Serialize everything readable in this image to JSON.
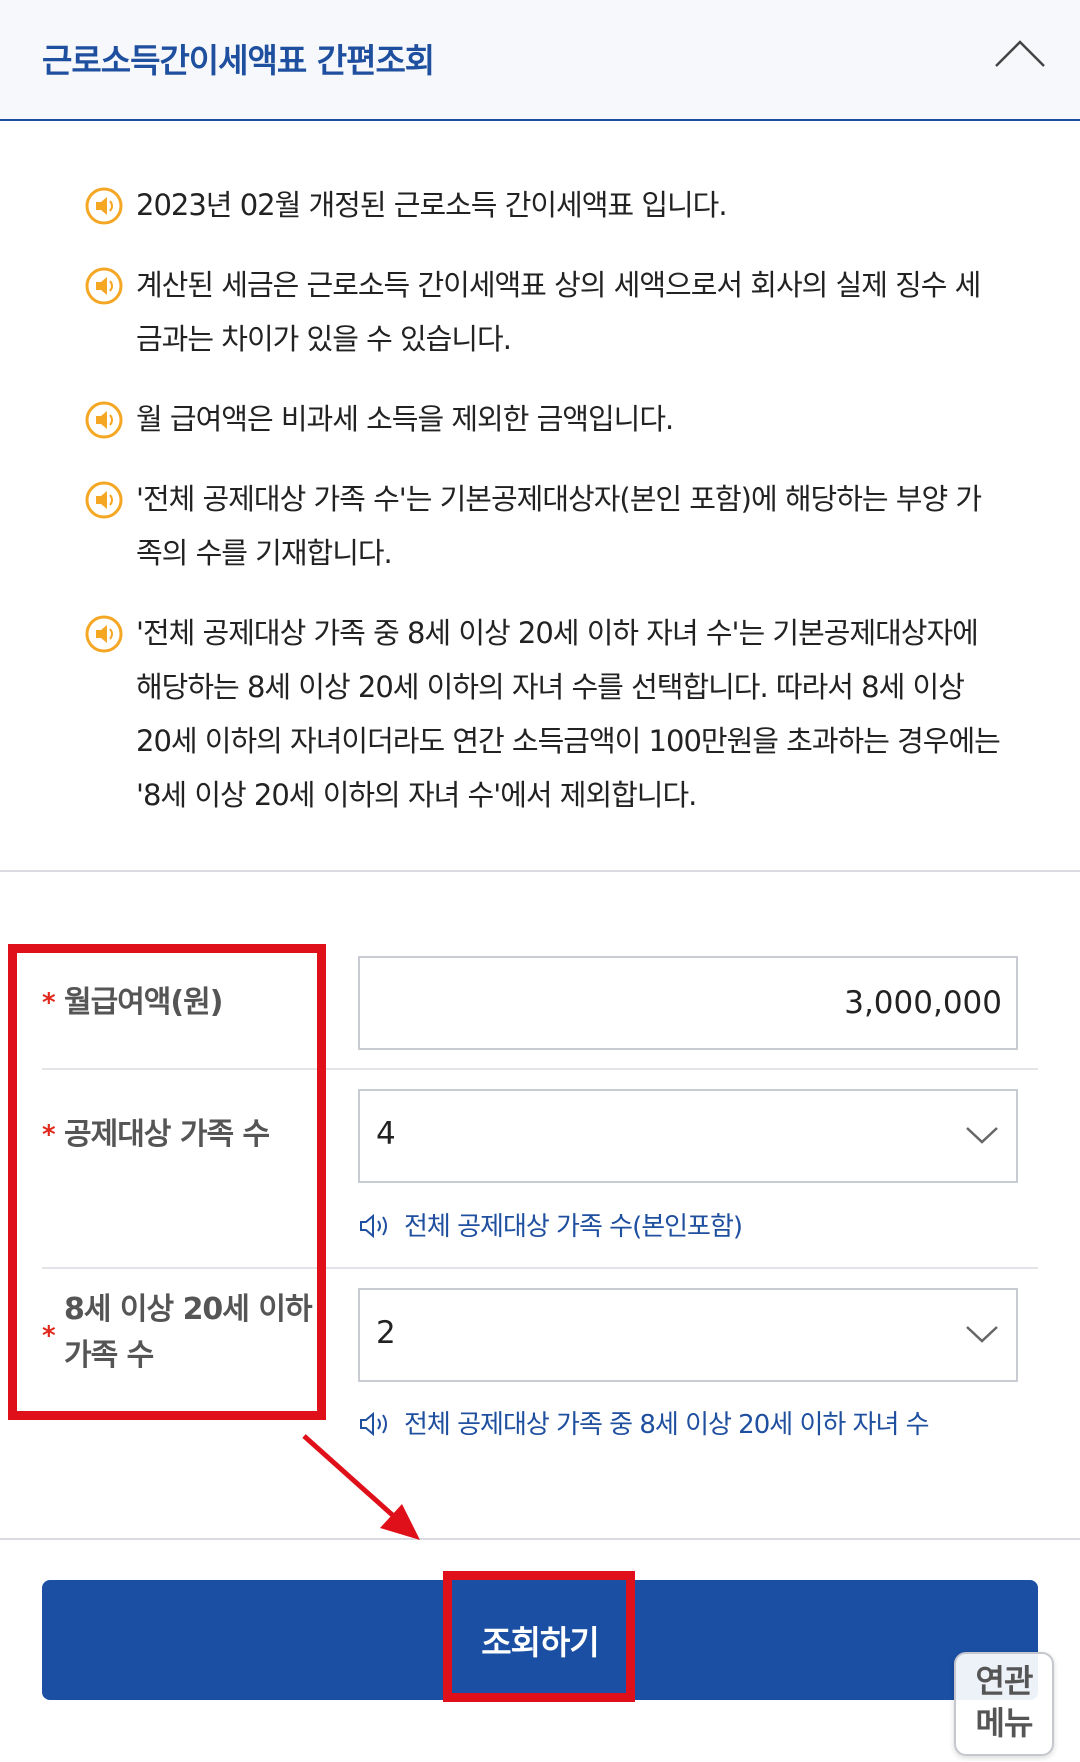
{
  "header": {
    "title": "근로소득간이세액표 간편조회"
  },
  "notices": [
    "2023년 02월 개정된 근로소득 간이세액표 입니다.",
    "계산된 세금은 근로소득 간이세액표 상의 세액으로서 회사의 실제 징수 세금과는 차이가 있을 수 있습니다.",
    "월 급여액은 비과세 소득을 제외한 금액입니다.",
    "'전체 공제대상 가족 수'는 기본공제대상자(본인 포함)에 해당하는 부양 가족의 수를 기재합니다.",
    "'전체 공제대상 가족 중 8세 이상 20세 이하 자녀 수'는 기본공제대상자에 해당하는 8세 이상 20세 이하의 자녀 수를 선택합니다. 따라서 8세 이상 20세 이하의 자녀이더라도 연간 소득금액이 100만원을 초과하는 경우에는 '8세 이상 20세 이하의 자녀 수'에서 제외합니다."
  ],
  "form": {
    "required_mark": "*",
    "salary": {
      "label": "월급여액(원)",
      "value": "3,000,000"
    },
    "family": {
      "label": "공제대상 가족 수",
      "value": "4",
      "hint": "전체 공제대상 가족 수(본인포함)"
    },
    "children": {
      "label_line1": "8세 이상 20세 이하",
      "label_line2": "가족 수",
      "value": "2",
      "hint": "전체 공제대상 가족 중 8세 이상 20세 이하 자녀 수"
    }
  },
  "search_button": "조회하기",
  "related_menu": {
    "line1": "연관",
    "line2": "메뉴"
  },
  "icons": {
    "header_toggle": "chevron-up-icon",
    "notice": "speaker-icon",
    "select": "chevron-down-icon",
    "hint": "speaker-outline-icon"
  },
  "colors": {
    "brand_blue": "#1a4fa3",
    "title_blue": "#1f4f9f",
    "required_red": "#e0281c",
    "notice_icon_orange": "#f5a623",
    "annotation_red": "#e0101a"
  }
}
